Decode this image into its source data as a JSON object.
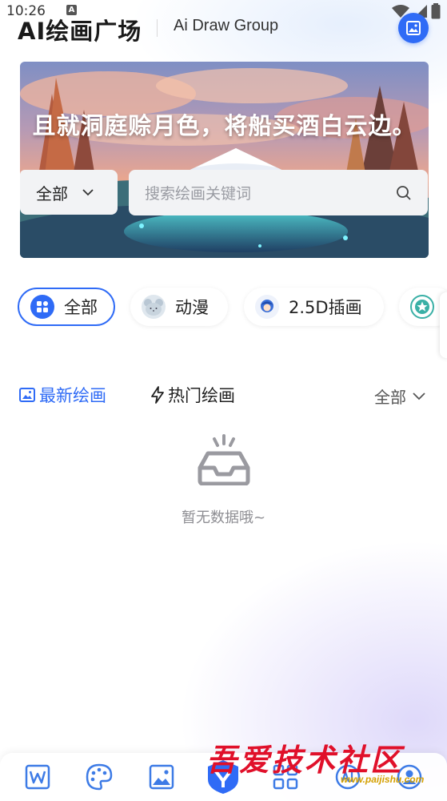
{
  "status_bar": {
    "time": "10:26",
    "notification_badge": "A",
    "icons": [
      "wifi-icon",
      "signal-icon",
      "battery-icon"
    ]
  },
  "header": {
    "title": "AI绘画广场",
    "subtitle": "Ai Draw Group",
    "gallery_button_icon": "image-icon"
  },
  "banner": {
    "quote": "且就洞庭赊月色，将船买酒白云边。",
    "filter_select": {
      "value": "全部",
      "icon": "chevron-down-icon"
    },
    "search": {
      "placeholder": "搜索绘画关键词",
      "icon": "search-icon"
    }
  },
  "categories": [
    {
      "label": "全部",
      "icon": "grid-icon",
      "active": true
    },
    {
      "label": "动漫",
      "icon": "mouse-face-icon",
      "active": false
    },
    {
      "label": "2.5D插画",
      "icon": "character-icon",
      "active": false
    },
    {
      "label": "",
      "icon": "star-badge-icon",
      "active": false
    }
  ],
  "tabs": [
    {
      "label": "最新绘画",
      "icon": "image-icon",
      "active": true
    },
    {
      "label": "热门绘画",
      "icon": "lightning-icon",
      "active": false
    }
  ],
  "sort_select": {
    "value": "全部",
    "icon": "chevron-down-icon"
  },
  "empty_state": {
    "icon": "empty-tray-icon",
    "text": "暂无数据哦~"
  },
  "bottom_nav": [
    {
      "icon": "word-doc-icon"
    },
    {
      "icon": "palette-icon"
    },
    {
      "icon": "image-icon"
    },
    {
      "icon": "shield-logo-icon"
    },
    {
      "icon": "apps-icon"
    },
    {
      "icon": "ai-icon"
    },
    {
      "icon": "profile-icon"
    }
  ],
  "watermark": {
    "text": "吾爱技术社区",
    "url": "www.paijishu.com"
  },
  "colors": {
    "accent": "#2f6bf6",
    "watermark": "#e0102a"
  }
}
